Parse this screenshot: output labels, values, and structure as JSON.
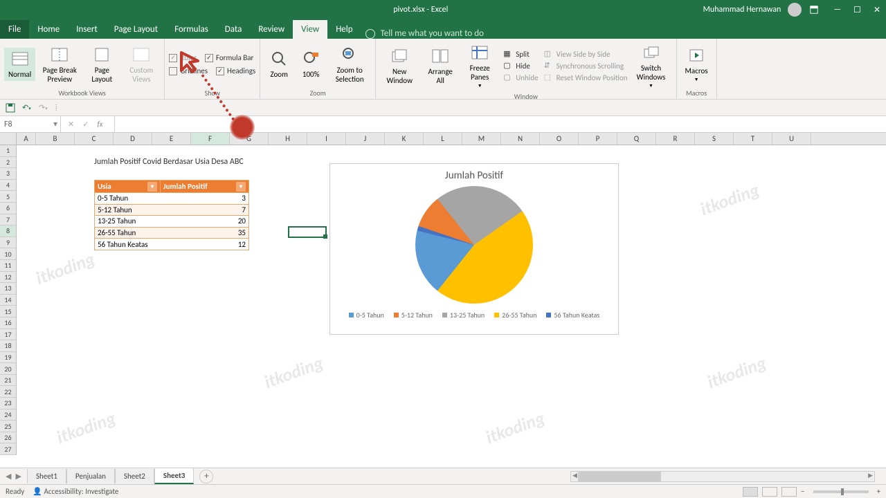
{
  "title_bar": {
    "title": "pivot.xlsx - Excel",
    "user": "Muhammad Hernawan"
  },
  "menu": {
    "tabs": [
      "File",
      "Home",
      "Insert",
      "Page Layout",
      "Formulas",
      "Data",
      "Review",
      "View",
      "Help"
    ],
    "active": "View",
    "tellme": "Tell me what you want to do"
  },
  "ribbon": {
    "workbook_views": {
      "label": "Workbook Views",
      "normal": "Normal",
      "page_break": "Page Break Preview",
      "page_layout": "Page Layout",
      "custom": "Custom Views"
    },
    "show": {
      "label": "Show",
      "ruler": "Ruler",
      "formula_bar": "Formula Bar",
      "gridlines": "Gridlines",
      "headings": "Headings"
    },
    "zoom": {
      "label": "Zoom",
      "zoom": "Zoom",
      "pct": "100%",
      "to_sel": "Zoom to Selection"
    },
    "window": {
      "label": "Window",
      "new": "New Window",
      "arrange": "Arrange All",
      "freeze": "Freeze Panes",
      "split": "Split",
      "hide": "Hide",
      "unhide": "Unhide",
      "sbs": "View Side by Side",
      "sync": "Synchronous Scrolling",
      "reset": "Reset Window Position",
      "switch": "Switch Windows"
    },
    "macros": {
      "label": "Macros",
      "macros": "Macros"
    }
  },
  "formula_bar": {
    "name_box": "F8",
    "formula": ""
  },
  "columns": [
    "A",
    "B",
    "C",
    "D",
    "E",
    "F",
    "G",
    "H",
    "I",
    "J",
    "K",
    "L",
    "M",
    "N",
    "O",
    "P",
    "Q",
    "R",
    "S",
    "T",
    "U"
  ],
  "sheet": {
    "title": "Jumlah Positif Covid Berdasar Usia Desa ABC",
    "headers": {
      "col1": "Usia",
      "col2": "Jumlah Positif"
    },
    "rows": [
      {
        "usia": "0-5 Tahun",
        "val": "3"
      },
      {
        "usia": "5-12 Tahun",
        "val": "7"
      },
      {
        "usia": "13-25 Tahun",
        "val": "20"
      },
      {
        "usia": "26-55 Tahun",
        "val": "35"
      },
      {
        "usia": "56 Tahun Keatas",
        "val": "12"
      }
    ]
  },
  "chart_data": {
    "type": "pie",
    "title": "Jumlah Positif",
    "categories": [
      "0-5 Tahun",
      "5-12 Tahun",
      "13-25 Tahun",
      "26-55 Tahun",
      "56 Tahun Keatas"
    ],
    "values": [
      3,
      7,
      20,
      35,
      12
    ],
    "colors": [
      "#5b9bd5",
      "#ed7d31",
      "#a5a5a5",
      "#ffc000",
      "#4472c4"
    ]
  },
  "sheets": {
    "tabs": [
      "Sheet1",
      "Penjualan",
      "Sheet2",
      "Sheet3"
    ],
    "active": "Sheet3"
  },
  "status": {
    "ready": "Ready",
    "accessibility": "Accessibility: Investigate",
    "zoom_plus": "+",
    "zoom_minus": "−"
  },
  "watermark": "itkoding"
}
